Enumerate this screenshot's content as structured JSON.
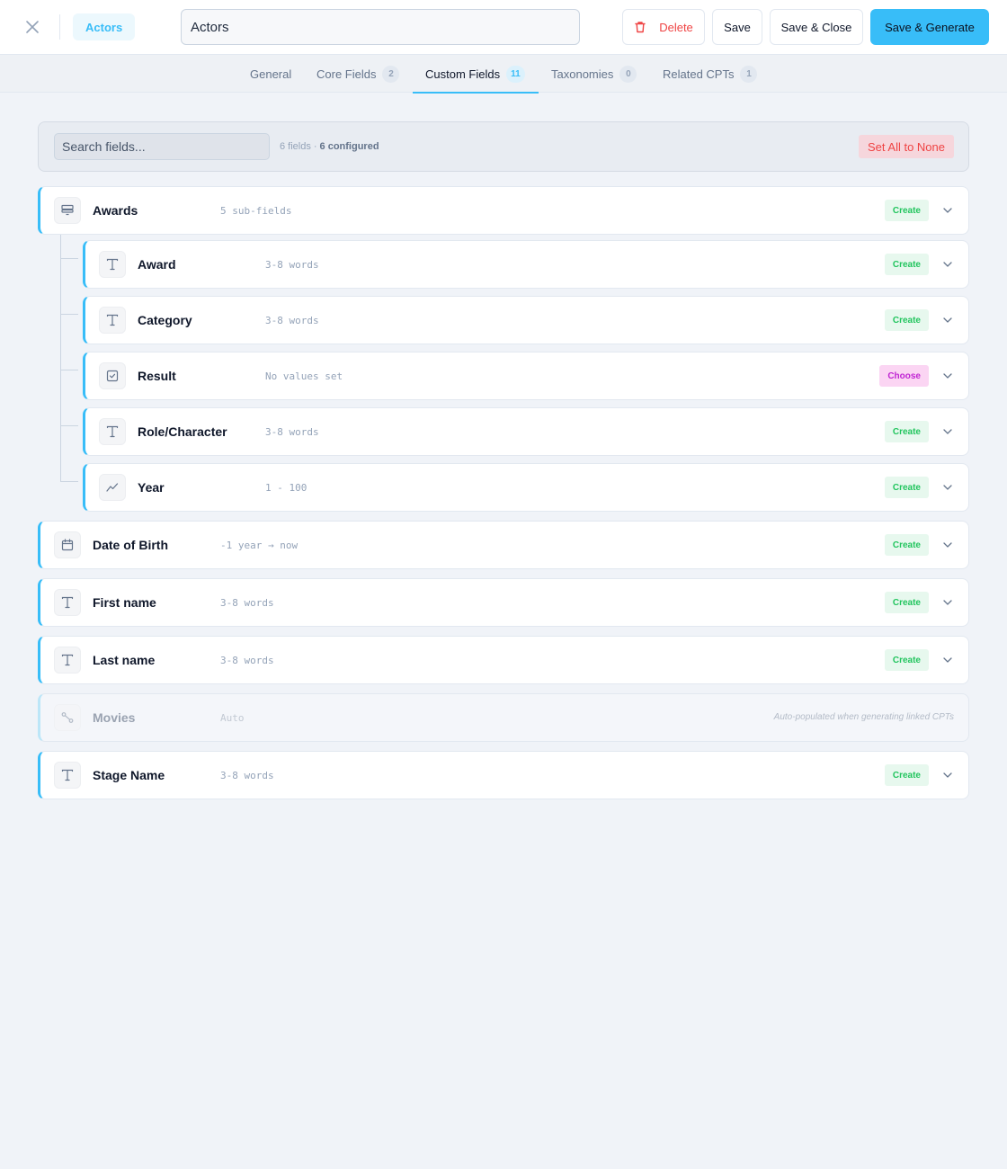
{
  "header": {
    "badge": "Actors",
    "title_value": "Actors",
    "buttons": {
      "delete": "Delete",
      "save": "Save",
      "save_close": "Save & Close",
      "save_generate": "Save & Generate"
    }
  },
  "tabs": [
    {
      "label": "General",
      "count": null,
      "active": false
    },
    {
      "label": "Core Fields",
      "count": "2",
      "active": false
    },
    {
      "label": "Custom Fields",
      "count": "11",
      "active": true
    },
    {
      "label": "Taxonomies",
      "count": "0",
      "active": false
    },
    {
      "label": "Related CPTs",
      "count": "1",
      "active": false
    }
  ],
  "search": {
    "placeholder": "Search fields...",
    "fields_count": "6 fields",
    "separator": "·",
    "configured": "6 configured",
    "set_all_none": "Set All to None"
  },
  "fields": [
    {
      "name": "Awards",
      "meta": "5 sub-fields",
      "icon": "repeater-icon",
      "action": "Create",
      "level": "top"
    },
    {
      "name": "Award",
      "meta": "3-8 words",
      "icon": "text-icon",
      "action": "Create",
      "level": "sub"
    },
    {
      "name": "Category",
      "meta": "3-8 words",
      "icon": "text-icon",
      "action": "Create",
      "level": "sub"
    },
    {
      "name": "Result",
      "meta": "No values set",
      "icon": "checkbox-icon",
      "action": "Choose",
      "level": "sub"
    },
    {
      "name": "Role/Character",
      "meta": "3-8 words",
      "icon": "text-icon",
      "action": "Create",
      "level": "sub"
    },
    {
      "name": "Year",
      "meta": "1 - 100",
      "icon": "number-icon",
      "action": "Create",
      "level": "sub"
    },
    {
      "name": "Date of Birth",
      "meta": "-1 year → now",
      "icon": "calendar-icon",
      "action": "Create",
      "level": "top"
    },
    {
      "name": "First name",
      "meta": "3-8 words",
      "icon": "text-icon",
      "action": "Create",
      "level": "top"
    },
    {
      "name": "Last name",
      "meta": "3-8 words",
      "icon": "text-icon",
      "action": "Create",
      "level": "top"
    },
    {
      "name": "Movies",
      "meta": "Auto",
      "icon": "relationship-icon",
      "note": "Auto-populated when generating linked CPTs",
      "level": "top"
    },
    {
      "name": "Stage Name",
      "meta": "3-8 words",
      "icon": "text-icon",
      "action": "Create",
      "level": "top"
    }
  ],
  "colors": {
    "accent": "#38bdf8",
    "danger": "#ef4444",
    "create": "#22c55e",
    "choose": "#c026d3",
    "background": "#f0f3f8"
  }
}
